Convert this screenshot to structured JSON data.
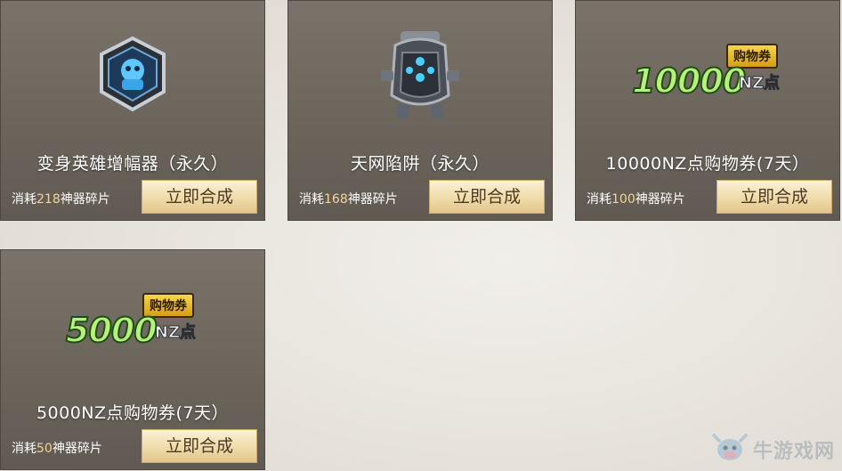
{
  "items": [
    {
      "title": "变身英雄增幅器（永久）",
      "cost_prefix": "消耗",
      "cost_num": "218",
      "cost_suffix": "神器碎片",
      "button_label": "立即合成",
      "art": "hero-amplifier-icon"
    },
    {
      "title": "天网陷阱（永久）",
      "cost_prefix": "消耗",
      "cost_num": "168",
      "cost_suffix": "神器碎片",
      "button_label": "立即合成",
      "art": "skynet-trap-icon"
    },
    {
      "title": "10000NZ点购物券(7天）",
      "cost_prefix": "消耗",
      "cost_num": "100",
      "cost_suffix": "神器碎片",
      "button_label": "立即合成",
      "art": "voucher-10000-icon",
      "voucher_amount": "10000",
      "voucher_unit": "NZ点",
      "voucher_tag": "购物券"
    },
    {
      "title": "5000NZ点购物券(7天）",
      "cost_prefix": "消耗",
      "cost_num": "50",
      "cost_suffix": "神器碎片",
      "button_label": "立即合成",
      "art": "voucher-5000-icon",
      "voucher_amount": "5000",
      "voucher_unit": "NZ点",
      "voucher_tag": "购物券"
    }
  ],
  "watermark": {
    "text": "牛游戏网",
    "icon": "cow-mascot-icon"
  },
  "colors": {
    "card_bg": "#6c655c",
    "button_bg": "#eed9a6",
    "cost_number": "#f2d59a"
  }
}
